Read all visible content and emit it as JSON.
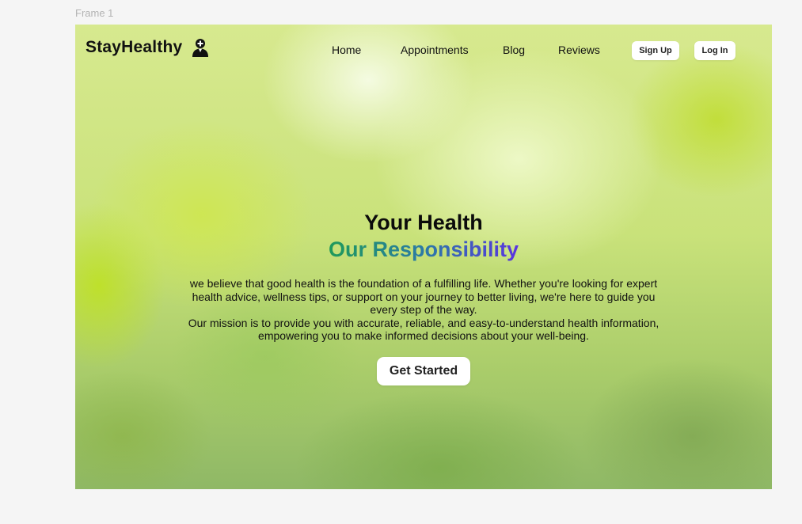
{
  "canvas": {
    "frame_label": "Frame 1"
  },
  "brand": {
    "name": "StayHealthy",
    "icon": "doctor-icon"
  },
  "nav": {
    "links": [
      "Home",
      "Appointments",
      "Blog",
      "Reviews"
    ],
    "signup_label": "Sign Up",
    "login_label": "Log In"
  },
  "hero": {
    "title": "Your Health",
    "subtitle": "Our Responsibility",
    "description_1": "we believe that good health is the foundation of a fulfilling life. Whether you're looking for expert health advice, wellness tips, or support on your journey to better living, we're here to guide you every step of the way.",
    "description_2": "Our mission is to provide you with accurate, reliable, and easy-to-understand health information, empowering you to make informed decisions about your well-being.",
    "cta_label": "Get Started"
  },
  "colors": {
    "subtitle_gradient_start": "#1f9a5a",
    "subtitle_gradient_end": "#5a34e0",
    "button_bg": "#ffffff",
    "canvas_bg": "#f5f5f5"
  }
}
